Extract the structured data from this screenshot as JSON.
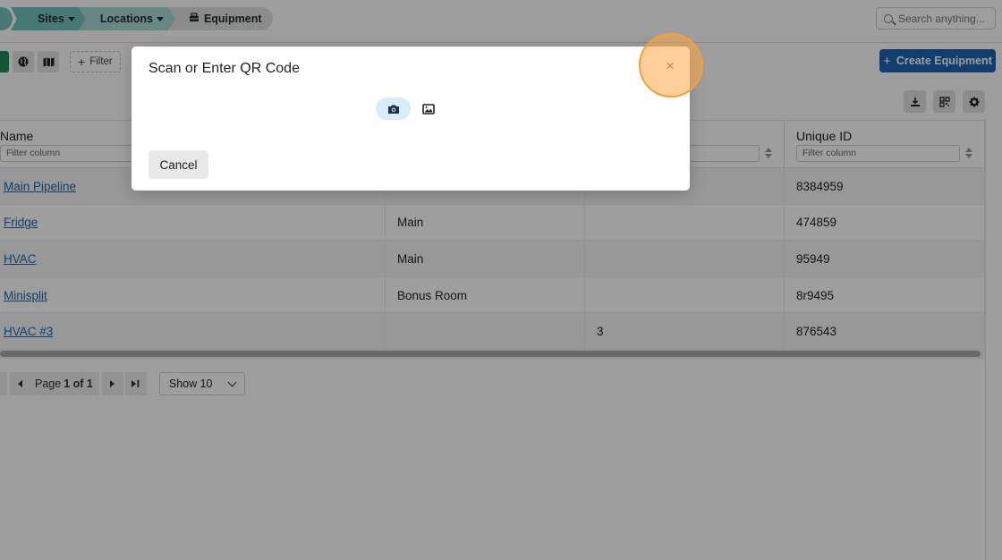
{
  "breadcrumb": {
    "items": [
      {
        "label": "Sites"
      },
      {
        "label": "Locations"
      },
      {
        "label": "Equipment"
      }
    ]
  },
  "search": {
    "placeholder": "Search anything..."
  },
  "toolbar": {
    "filter_label": "Filter",
    "create_label": "Create Equipment"
  },
  "table": {
    "columns": [
      {
        "label": "Name",
        "filter_placeholder": "Filter column"
      },
      {
        "label": "",
        "filter_placeholder": ""
      },
      {
        "label": "",
        "filter_placeholder": ""
      },
      {
        "label": "Unique ID",
        "filter_placeholder": "Filter column"
      }
    ],
    "rows": [
      {
        "name": "Main Pipeline",
        "location": "",
        "col3": "",
        "uid": "8384959"
      },
      {
        "name": "Fridge",
        "location": "Main",
        "col3": "",
        "uid": "474859"
      },
      {
        "name": "HVAC",
        "location": "Main",
        "col3": "",
        "uid": "95949"
      },
      {
        "name": "Minisplit",
        "location": "Bonus Room",
        "col3": "",
        "uid": "8r9495"
      },
      {
        "name": "HVAC #3",
        "location": "",
        "col3": "3",
        "uid": "876543"
      }
    ]
  },
  "pagination": {
    "page_prefix": "Page",
    "page_current": "1 of 1",
    "show_label": "Show 10"
  },
  "modal": {
    "title": "Scan or Enter QR Code",
    "cancel_label": "Cancel",
    "close_symbol": "×"
  },
  "colors": {
    "accent": "#1b64b0",
    "breadcrumb": "#74c2bd",
    "highlight": "#f0a03c"
  }
}
